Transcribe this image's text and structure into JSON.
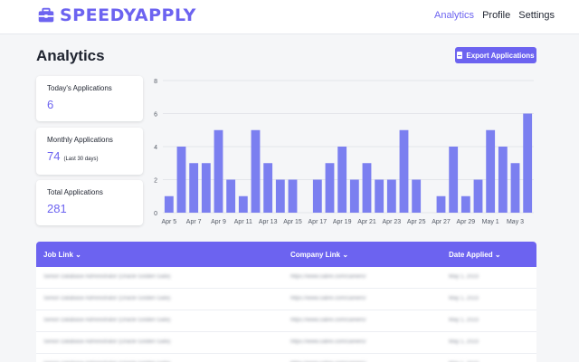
{
  "brand": {
    "name": "SPEEDYAPPLY",
    "color": "#6c63f0",
    "icon": "briefcase-icon"
  },
  "nav": {
    "analytics": "Analytics",
    "profile": "Profile",
    "settings": "Settings"
  },
  "page": {
    "title": "Analytics",
    "export_label": "Export Applications",
    "export_icon": "document-icon"
  },
  "cards": {
    "today": {
      "label": "Today's Applications",
      "value": "6"
    },
    "monthly": {
      "label": "Monthly Applications",
      "value": "74",
      "note": "(Last 30 days)"
    },
    "total": {
      "label": "Total Applications",
      "value": "281"
    }
  },
  "chart_data": {
    "type": "bar",
    "color": "#7b7ff0",
    "ylim": [
      0,
      8
    ],
    "yticks": [
      0,
      2,
      4,
      6,
      8
    ],
    "grid": true,
    "categories": [
      "Apr 5",
      "Apr 6",
      "Apr 7",
      "Apr 8",
      "Apr 9",
      "Apr 10",
      "Apr 11",
      "Apr 12",
      "Apr 13",
      "Apr 14",
      "Apr 15",
      "Apr 16",
      "Apr 17",
      "Apr 18",
      "Apr 19",
      "Apr 20",
      "Apr 21",
      "Apr 22",
      "Apr 23",
      "Apr 24",
      "Apr 25",
      "Apr 26",
      "Apr 27",
      "Apr 28",
      "Apr 29",
      "Apr 30",
      "May 1",
      "May 2",
      "May 3",
      "May 4"
    ],
    "values": [
      1,
      4,
      3,
      3,
      5,
      2,
      1,
      5,
      3,
      2,
      2,
      0,
      2,
      3,
      4,
      2,
      3,
      2,
      2,
      5,
      2,
      0,
      1,
      4,
      1,
      2,
      5,
      4,
      3,
      6
    ],
    "xtick_labels": [
      "Apr 5",
      "Apr 7",
      "Apr 9",
      "Apr 11",
      "Apr 13",
      "Apr 15",
      "Apr 17",
      "Apr 19",
      "Apr 21",
      "Apr 23",
      "Apr 25",
      "Apr 27",
      "Apr 29",
      "May 1",
      "May 3"
    ]
  },
  "table": {
    "headers": {
      "job": "Job Link ⌄",
      "company": "Company Link ⌄",
      "date": "Date Applied ⌄"
    },
    "rows": [
      {
        "job": "Senior Database Administrator (Oracle Golden Gate)",
        "company": "https://www.cabre.com/careers/",
        "date": "May 1, 2023"
      },
      {
        "job": "Senior Database Administrator (Oracle Golden Gate)",
        "company": "https://www.cabre.com/careers/",
        "date": "May 1, 2023"
      },
      {
        "job": "Senior Database Administrator (Oracle Golden Gate)",
        "company": "https://www.cabre.com/careers/",
        "date": "May 1, 2023"
      },
      {
        "job": "Senior Database Administrator (Oracle Golden Gate)",
        "company": "https://www.cabre.com/careers/",
        "date": "May 1, 2023"
      },
      {
        "job": "Senior Database Administrator (Oracle Golden Gate)",
        "company": "https://www.cabre.com/careers/",
        "date": "May 1, 2023"
      }
    ]
  }
}
